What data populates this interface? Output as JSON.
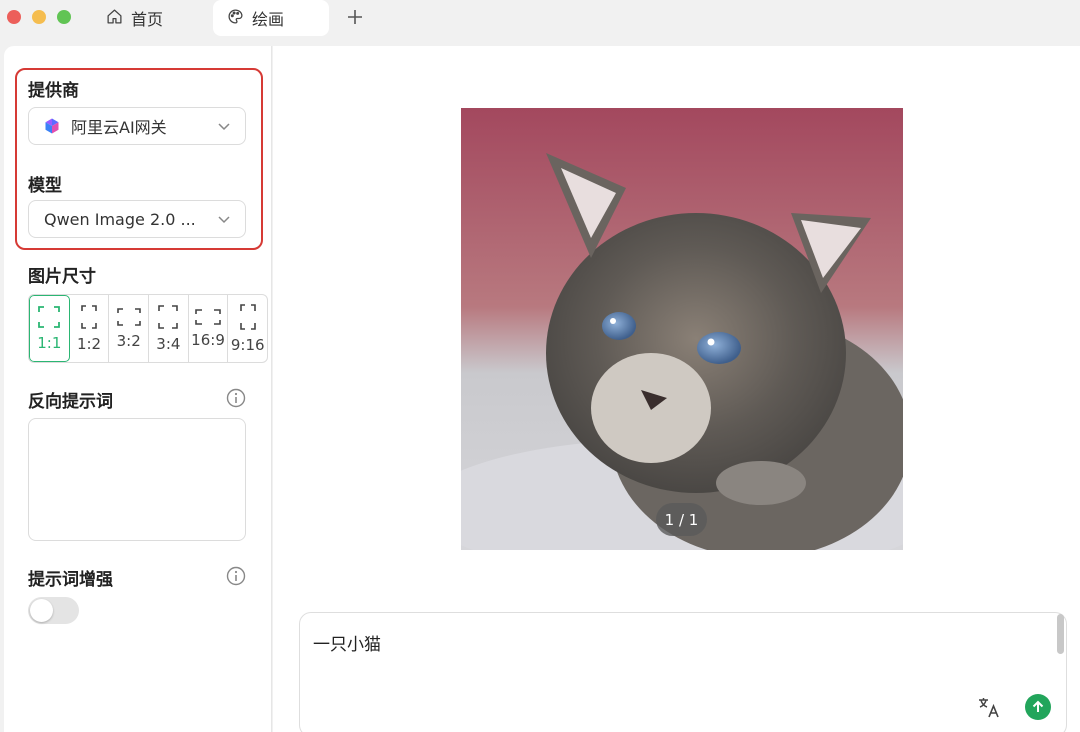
{
  "tabs": {
    "home": "首页",
    "paint": "绘画"
  },
  "sidebar": {
    "provider_label": "提供商",
    "provider_value": "阿里云AI网关",
    "model_label": "模型",
    "model_value": "Qwen Image 2.0 ...",
    "size_label": "图片尺寸",
    "ratios": [
      "1:1",
      "1:2",
      "3:2",
      "3:4",
      "16:9",
      "9:16"
    ],
    "selected_ratio": "1:1",
    "negative_prompt_label": "反向提示词",
    "negative_prompt_value": "",
    "enhance_label": "提示词增强",
    "enhance_enabled": false
  },
  "viewer": {
    "counter": "1 / 1"
  },
  "prompt": {
    "value": "一只小猫"
  },
  "colors": {
    "accent": "#2bb673",
    "highlight": "#d63a35",
    "send": "#22a55b"
  }
}
